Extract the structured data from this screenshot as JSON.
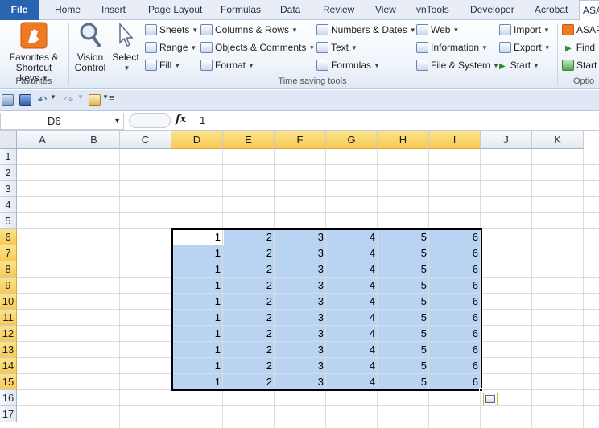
{
  "tabs": [
    "File",
    "Home",
    "Insert",
    "Page Layout",
    "Formulas",
    "Data",
    "Review",
    "View",
    "vnTools",
    "Developer",
    "Acrobat",
    "ASAP"
  ],
  "active_tab": "ASAP",
  "ribbon": {
    "favorites_label": "Favorites &",
    "favorites_label2": "Shortcut keys",
    "favorites_group": "Favorites",
    "vision_label": "Vision",
    "vision_label2": "Control",
    "select_label": "Select",
    "col1": [
      "Sheets",
      "Range",
      "Fill"
    ],
    "col2": [
      "Columns & Rows",
      "Objects & Comments",
      "Format"
    ],
    "col3": [
      "Numbers & Dates",
      "Text",
      "Formulas"
    ],
    "col4": [
      "Web",
      "Information",
      "File & System"
    ],
    "col5": [
      "Import",
      "Export",
      "Start"
    ],
    "col6": [
      "ASAP",
      "Find",
      "Start"
    ],
    "group_time": "Time saving tools",
    "group_opt": "Optio"
  },
  "formula_bar": {
    "name_box": "D6",
    "fx": "fx",
    "value": "1"
  },
  "columns": [
    "A",
    "B",
    "C",
    "D",
    "E",
    "F",
    "G",
    "H",
    "I",
    "J",
    "K"
  ],
  "selected_columns": [
    "D",
    "E",
    "F",
    "G",
    "H",
    "I"
  ],
  "rows": [
    "1",
    "2",
    "3",
    "4",
    "5",
    "6",
    "7",
    "8",
    "9",
    "10",
    "11",
    "12",
    "13",
    "14",
    "15",
    "16",
    "17"
  ],
  "selected_rows": [
    "6",
    "7",
    "8",
    "9",
    "10",
    "11",
    "12",
    "13",
    "14",
    "15"
  ],
  "cells": [
    [
      "1",
      "2",
      "3",
      "4",
      "5",
      "6"
    ],
    [
      "1",
      "2",
      "3",
      "4",
      "5",
      "6"
    ],
    [
      "1",
      "2",
      "3",
      "4",
      "5",
      "6"
    ],
    [
      "1",
      "2",
      "3",
      "4",
      "5",
      "6"
    ],
    [
      "1",
      "2",
      "3",
      "4",
      "5",
      "6"
    ],
    [
      "1",
      "2",
      "3",
      "4",
      "5",
      "6"
    ],
    [
      "1",
      "2",
      "3",
      "4",
      "5",
      "6"
    ],
    [
      "1",
      "2",
      "3",
      "4",
      "5",
      "6"
    ],
    [
      "1",
      "2",
      "3",
      "4",
      "5",
      "6"
    ],
    [
      "1",
      "2",
      "3",
      "4",
      "5",
      "6"
    ]
  ],
  "colors": {
    "accent": "#2a64b0",
    "selection": "#b9d4f2",
    "header_selected": "#f8ca55"
  }
}
